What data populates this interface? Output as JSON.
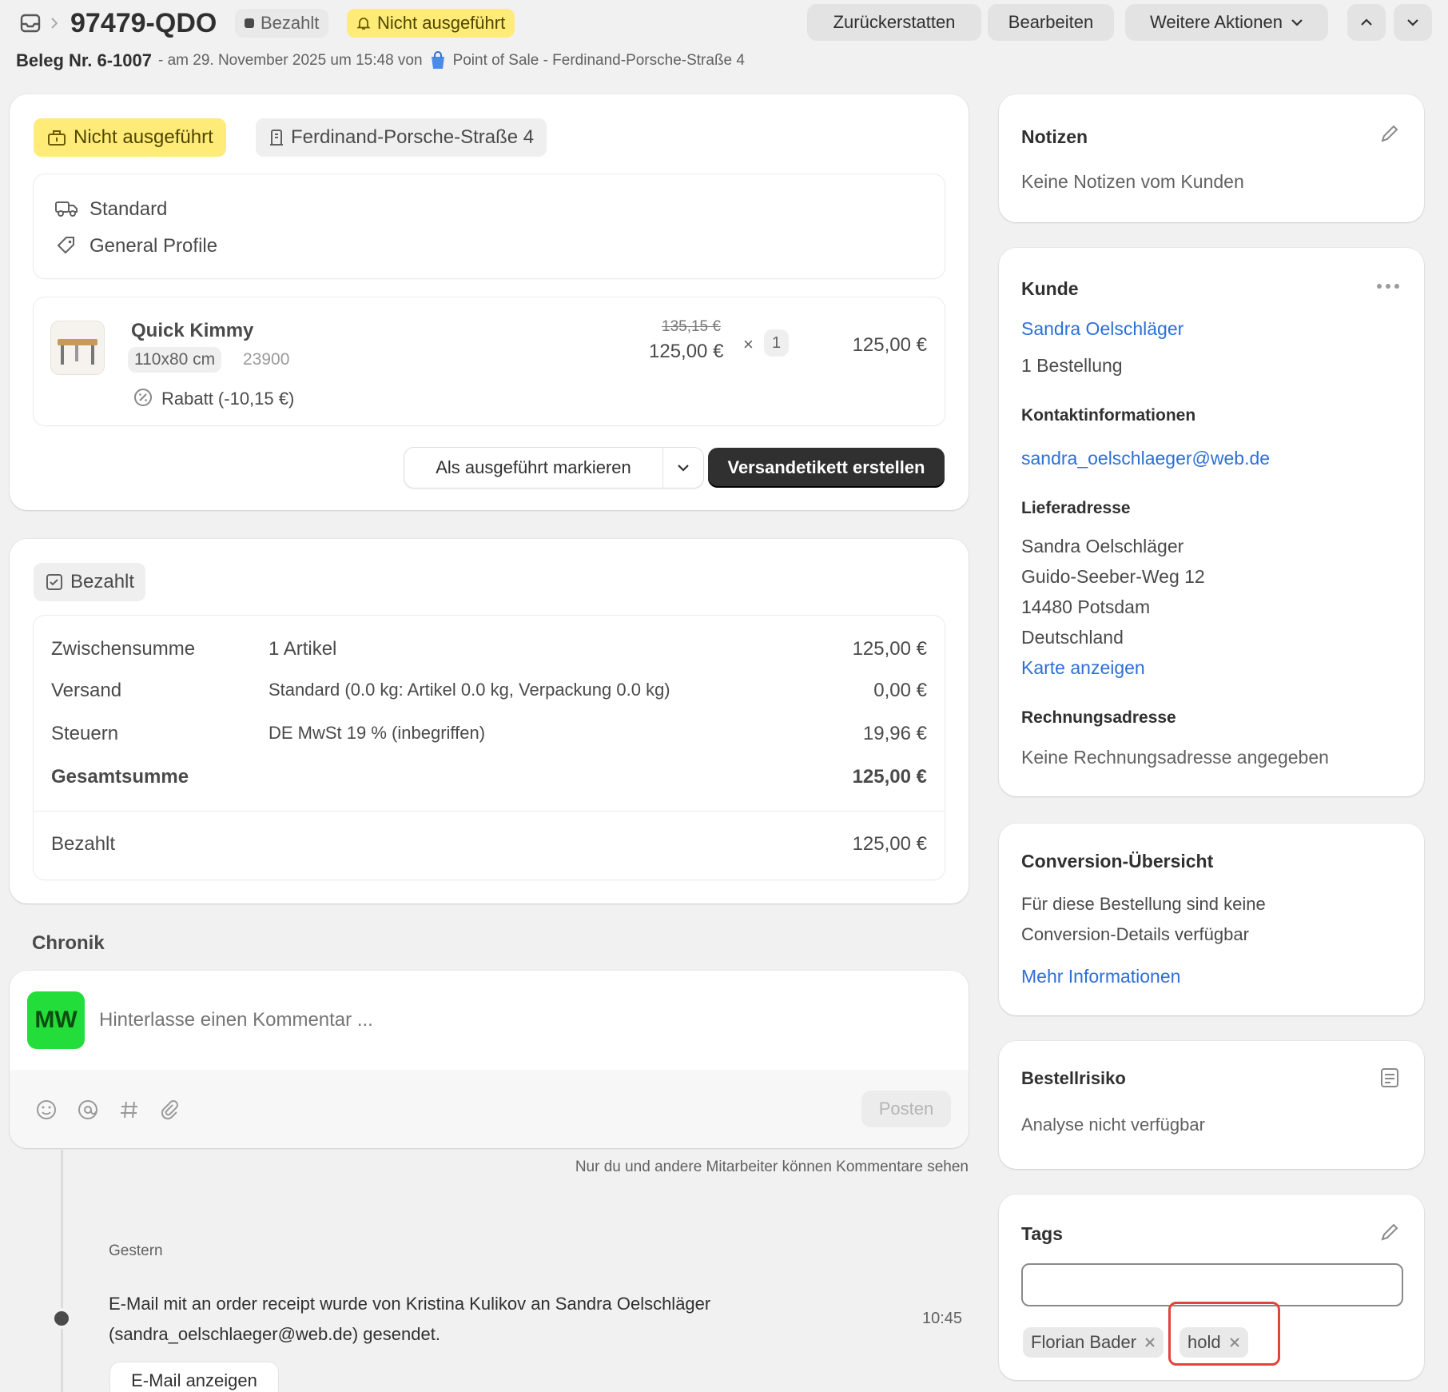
{
  "header": {
    "order_id": "97479-QDO",
    "paid_badge": "Bezahlt",
    "unfulfilled_badge": "Nicht ausgeführt",
    "refund_button": "Zurückerstatten",
    "edit_button": "Bearbeiten",
    "more_actions_button": "Weitere Aktionen",
    "receipt_label": "Beleg Nr. 6-1007",
    "receipt_meta": "- am 29. November 2025 um 15:48 von",
    "pos_location": "Point of Sale - Ferdinand-Porsche-Straße 4"
  },
  "fulfillment": {
    "status_badge": "Nicht ausgeführt",
    "location_badge": "Ferdinand-Porsche-Straße 4",
    "shipping_method": "Standard",
    "profile": "General Profile",
    "item": {
      "name": "Quick Kimmy",
      "variant": "110x80 cm",
      "sku": "23900",
      "original_price": "135,15 €",
      "price": "125,00 €",
      "times": "×",
      "quantity": "1",
      "total": "125,00 €",
      "discount": "Rabatt (-10,15 €)"
    },
    "mark_fulfilled_button": "Als ausgeführt markieren",
    "create_label_button": "Versandetikett erstellen"
  },
  "payment": {
    "badge": "Bezahlt",
    "rows": [
      {
        "label": "Zwischensumme",
        "detail": "1 Artikel",
        "amount": "125,00 €"
      },
      {
        "label": "Versand",
        "detail": "Standard (0.0 kg: Artikel 0.0 kg, Verpackung 0.0 kg)",
        "amount": "0,00 €"
      },
      {
        "label": "Steuern",
        "detail": "DE MwSt 19 % (inbegriffen)",
        "amount": "19,96 €"
      },
      {
        "label": "Gesamtsumme",
        "detail": "",
        "amount": "125,00 €"
      }
    ],
    "paid_label": "Bezahlt",
    "paid_amount": "125,00 €"
  },
  "timeline": {
    "title": "Chronik",
    "avatar_initials": "MW",
    "comment_placeholder": "Hinterlasse einen Kommentar ...",
    "post_button": "Posten",
    "visibility_note": "Nur du und andere Mitarbeiter können Kommentare sehen",
    "date_group": "Gestern",
    "event_text_1": "E-Mail mit an order receipt wurde von Kristina Kulikov an Sandra Oelschläger",
    "event_text_2": "(sandra_oelschlaeger@web.de) gesendet.",
    "event_time": "10:45",
    "show_email_button": "E-Mail anzeigen"
  },
  "notes": {
    "title": "Notizen",
    "text": "Keine Notizen vom Kunden"
  },
  "customer": {
    "title": "Kunde",
    "name": "Sandra Oelschläger",
    "orders": "1 Bestellung",
    "contact_title": "Kontaktinformationen",
    "email": "sandra_oelschlaeger@web.de",
    "shipping_title": "Lieferadresse",
    "address_name": "Sandra Oelschläger",
    "address_street": "Guido-Seeber-Weg 12",
    "address_city": "14480 Potsdam",
    "address_country": "Deutschland",
    "map_link": "Karte anzeigen",
    "billing_title": "Rechnungsadresse",
    "billing_text": "Keine Rechnungsadresse angegeben"
  },
  "conversion": {
    "title": "Conversion-Übersicht",
    "text_1": "Für diese Bestellung sind keine",
    "text_2": "Conversion-Details verfügbar",
    "more_link": "Mehr Informationen"
  },
  "risk": {
    "title": "Bestellrisiko",
    "text": "Analyse nicht verfügbar"
  },
  "tags": {
    "title": "Tags",
    "input_value": "",
    "items": [
      "Florian Bader",
      "hold"
    ]
  },
  "colors": {
    "accent_yellow": "#ffeb78",
    "primary_dark": "#303030",
    "link_blue": "#2d6fd6",
    "avatar_green": "#22dd3a",
    "highlight_red": "#e0453a"
  }
}
